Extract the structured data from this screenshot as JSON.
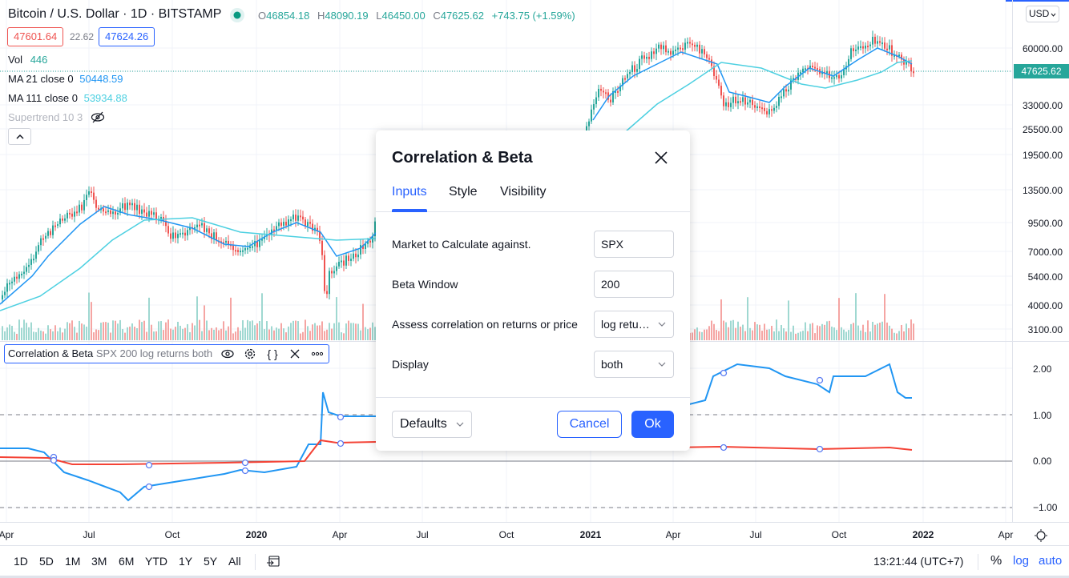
{
  "symbol": {
    "title": "Bitcoin / U.S. Dollar · 1D · BITSTAMP",
    "status_color": "#089981",
    "ohlc": [
      {
        "key": "O",
        "value": "46854.18"
      },
      {
        "key": "H",
        "value": "48090.19"
      },
      {
        "key": "L",
        "value": "46450.00"
      },
      {
        "key": "C",
        "value": "47625.62"
      }
    ],
    "change": "+743.75 (+1.59%)",
    "bid": "47601.64",
    "spread": "22.62",
    "ask": "47624.26"
  },
  "legend": {
    "vol_label": "Vol",
    "vol_value": "446",
    "ma21_label": "MA 21 close 0",
    "ma21_value": "50448.59",
    "ma111_label": "MA 111 close 0",
    "ma111_value": "53934.88",
    "supertrend_label": "Supertrend 10 3"
  },
  "price_axis": {
    "currency": "USD",
    "labels": [
      "60000.00",
      "47625.62",
      "33000.00",
      "25500.00",
      "19500.00",
      "13500.00",
      "9500.00",
      "7000.00",
      "5400.00",
      "4000.00",
      "3100.00"
    ],
    "last_price": "47625.62",
    "indicator_labels": [
      "2.00",
      "1.00",
      "0.00",
      "−1.00"
    ]
  },
  "time_axis": {
    "labels": [
      {
        "text": "Apr",
        "bold": false
      },
      {
        "text": "Jul",
        "bold": false
      },
      {
        "text": "Oct",
        "bold": false
      },
      {
        "text": "2020",
        "bold": true
      },
      {
        "text": "Apr",
        "bold": false
      },
      {
        "text": "Jul",
        "bold": false
      },
      {
        "text": "Oct",
        "bold": false
      },
      {
        "text": "2021",
        "bold": true
      },
      {
        "text": "Apr",
        "bold": false
      },
      {
        "text": "Jul",
        "bold": false
      },
      {
        "text": "Oct",
        "bold": false
      },
      {
        "text": "2022",
        "bold": true
      },
      {
        "text": "Apr",
        "bold": false
      }
    ]
  },
  "indicator": {
    "name": "Correlation & Beta",
    "params": "SPX 200 log returns both"
  },
  "dialog": {
    "title": "Correlation & Beta",
    "tabs": [
      "Inputs",
      "Style",
      "Visibility"
    ],
    "active_tab": "Inputs",
    "fields": [
      {
        "label": "Market to Calculate against.",
        "value": "SPX",
        "type": "input"
      },
      {
        "label": "Beta Window",
        "value": "200",
        "type": "input"
      },
      {
        "label": "Assess correlation on returns or price",
        "value": "log retu…",
        "type": "select"
      },
      {
        "label": "Display",
        "value": "both",
        "type": "select"
      }
    ],
    "defaults_label": "Defaults",
    "cancel_label": "Cancel",
    "ok_label": "Ok"
  },
  "bottom_bar": {
    "ranges": [
      "1D",
      "5D",
      "1M",
      "3M",
      "6M",
      "YTD",
      "1Y",
      "5Y",
      "All"
    ],
    "clock": "13:21:44 (UTC+7)",
    "percent_label": "%",
    "log_label": "log",
    "auto_label": "auto"
  },
  "colors": {
    "up": "#26a69a",
    "down": "#ef5350",
    "ma21": "#2196f3",
    "ma111": "#4dd0e1",
    "corr": "#2196f3",
    "beta": "#f44336",
    "accent": "#2962ff"
  }
}
